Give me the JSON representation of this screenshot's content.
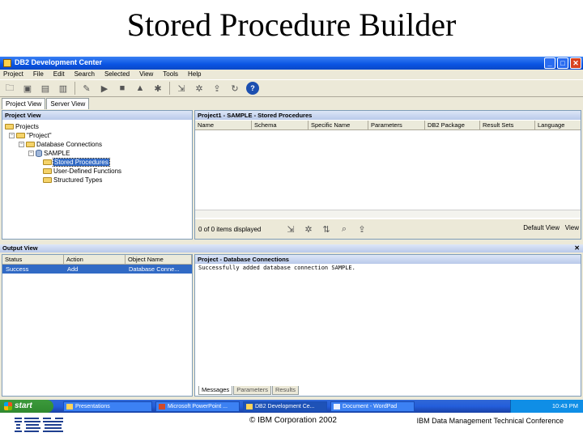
{
  "slide": {
    "title": "Stored Procedure Builder"
  },
  "window": {
    "title": "DB2 Development Center",
    "buttons": {
      "minimize": "_",
      "maximize": "□",
      "close": "✕"
    }
  },
  "menu": [
    "Project",
    "File",
    "Edit",
    "Search",
    "Selected",
    "View",
    "Tools",
    "Help"
  ],
  "tabs": [
    "Project View",
    "Server View"
  ],
  "project_view": {
    "header": "Project View",
    "tree": {
      "projects": "Projects",
      "project": "\"Project\"",
      "db_connections": "Database Connections",
      "sample": "SAMPLE",
      "stored_procedures": "Stored Procedures",
      "udfs": "User-Defined Functions",
      "structured_types": "Structured Types"
    }
  },
  "contents": {
    "header": "Project1 - SAMPLE - Stored Procedures",
    "columns": [
      "Name",
      "Schema",
      "Specific Name",
      "Parameters",
      "DB2 Package",
      "Result Sets",
      "Language"
    ],
    "items_text": "0 of 0 items displayed",
    "default_view": "Default View",
    "view_label": "View"
  },
  "output_view": {
    "header": "Output View",
    "close": "✕",
    "columns": [
      "Status",
      "Action",
      "Object Name"
    ],
    "row": {
      "status": "Success",
      "action": "Add",
      "object": "Database Conne..."
    }
  },
  "messages": {
    "header": "Project - Database Connections",
    "text": "Successfully added database connection SAMPLE.",
    "tabs": [
      "Messages",
      "Parameters",
      "Results"
    ]
  },
  "taskbar": {
    "start": "start",
    "items": [
      "Presentations",
      "Microsoft PowerPoint ...",
      "DB2 Development Ce...",
      "Document - WordPad"
    ],
    "clock": "10:43 PM"
  },
  "footer": {
    "logo": "IBM",
    "copyright": "© IBM Corporation 2002",
    "conference": "IBM Data Management Technical Conference"
  }
}
